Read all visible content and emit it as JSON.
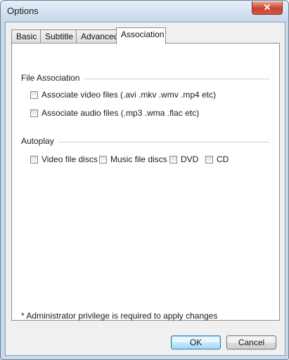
{
  "window": {
    "title": "Options",
    "close_glyph": "✕"
  },
  "tabs": [
    {
      "label": "Basic"
    },
    {
      "label": "Subtitle"
    },
    {
      "label": "Advanced"
    },
    {
      "label": "Association",
      "active": true
    }
  ],
  "file_association": {
    "heading": "File Association",
    "video": {
      "label": "Associate video files (.avi .mkv .wmv .mp4 etc)",
      "checked": false
    },
    "audio": {
      "label": "Associate audio files (.mp3 .wma .flac etc)",
      "checked": false
    }
  },
  "autoplay": {
    "heading": "Autoplay",
    "video_discs": {
      "label": "Video file discs",
      "checked": false
    },
    "music_discs": {
      "label": "Music file discs",
      "checked": false
    },
    "dvd": {
      "label": "DVD",
      "checked": false
    },
    "cd": {
      "label": "CD",
      "checked": false
    }
  },
  "note": "* Administrator privilege is required to apply changes",
  "buttons": {
    "ok": "OK",
    "cancel": "Cancel"
  }
}
